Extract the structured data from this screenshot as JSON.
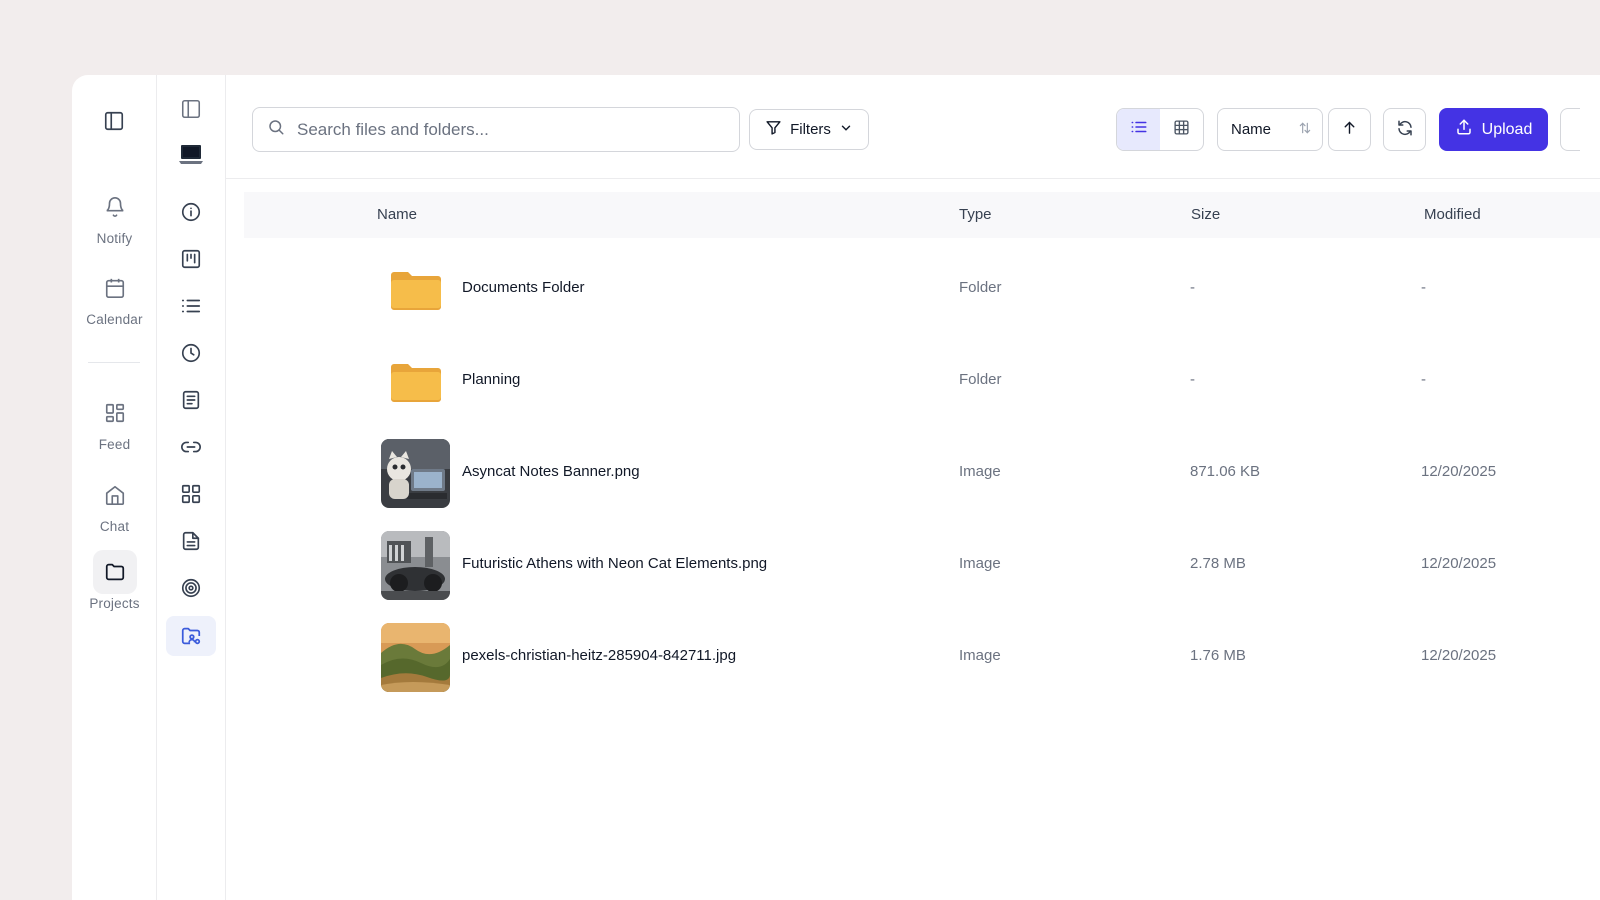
{
  "rail": {
    "items": [
      {
        "label": "Notify",
        "icon": "bell-icon"
      },
      {
        "label": "Calendar",
        "icon": "calendar-icon"
      },
      {
        "label": "Feed",
        "icon": "feed-grid-icon"
      },
      {
        "label": "Chat",
        "icon": "home-icon"
      },
      {
        "label": "Projects",
        "icon": "folder-icon"
      }
    ]
  },
  "rail2": {
    "icons": [
      "sidebar-toggle-icon",
      "laptop-icon",
      "info-icon",
      "kanban-icon",
      "list-icon",
      "clock-icon",
      "notes-icon",
      "link-icon",
      "grid-icon",
      "document-icon",
      "target-icon",
      "shared-folder-icon"
    ]
  },
  "toolbar": {
    "search_placeholder": "Search files and folders...",
    "filters_label": "Filters",
    "sort_label": "Name",
    "upload_label": "Upload",
    "accent": "#4433e4"
  },
  "table": {
    "headers": {
      "name": "Name",
      "type": "Type",
      "size": "Size",
      "modified": "Modified"
    },
    "rows": [
      {
        "name": "Documents Folder",
        "type": "Folder",
        "size": "-",
        "modified": "-",
        "kind": "folder"
      },
      {
        "name": "Planning",
        "type": "Folder",
        "size": "-",
        "modified": "-",
        "kind": "folder"
      },
      {
        "name": "Asyncat Notes Banner.png",
        "type": "Image",
        "size": "871.06 KB",
        "modified": "12/20/2025",
        "kind": "image"
      },
      {
        "name": "Futuristic Athens with Neon Cat Elements.png",
        "type": "Image",
        "size": "2.78 MB",
        "modified": "12/20/2025",
        "kind": "image"
      },
      {
        "name": "pexels-christian-heitz-285904-842711.jpg",
        "type": "Image",
        "size": "1.76 MB",
        "modified": "12/20/2025",
        "kind": "image"
      }
    ]
  }
}
